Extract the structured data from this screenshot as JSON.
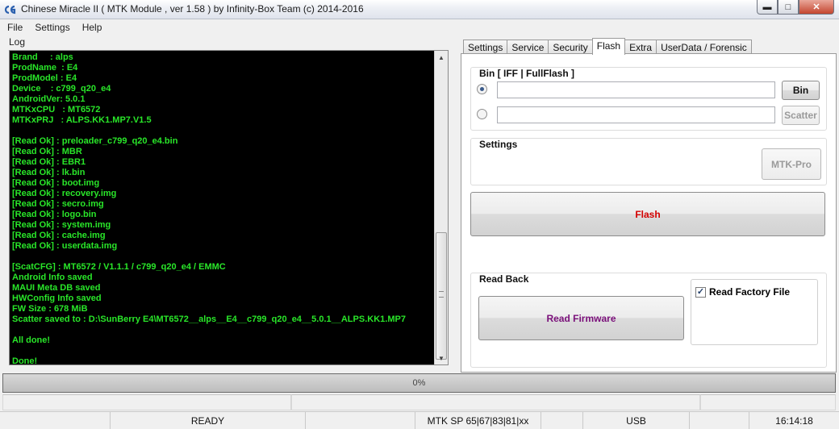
{
  "window": {
    "title": "Chinese Miracle II ( MTK Module , ver 1.58 ) by Infinity-Box Team (c) 2014-2016",
    "minimize_glyph": "▬",
    "maximize_glyph": "□",
    "close_glyph": "✕"
  },
  "menu": [
    "File",
    "Settings",
    "Help"
  ],
  "log": {
    "label": "Log",
    "lines": [
      "Brand     : alps",
      "ProdName  : E4",
      "ProdModel : E4",
      "Device    : c799_q20_e4",
      "AndroidVer: 5.0.1",
      "MTKxCPU   : MT6572",
      "MTKxPRJ   : ALPS.KK1.MP7.V1.5",
      "",
      "[Read Ok] : preloader_c799_q20_e4.bin",
      "[Read Ok] : MBR",
      "[Read Ok] : EBR1",
      "[Read Ok] : lk.bin",
      "[Read Ok] : boot.img",
      "[Read Ok] : recovery.img",
      "[Read Ok] : secro.img",
      "[Read Ok] : logo.bin",
      "[Read Ok] : system.img",
      "[Read Ok] : cache.img",
      "[Read Ok] : userdata.img",
      "",
      "[ScatCFG] : MT6572 / V1.1.1 / c799_q20_e4 / EMMC",
      "Android Info saved",
      "MAUI Meta DB saved",
      "HWConfig Info saved",
      "FW Size : 678 MiB",
      "Scatter saved to : D:\\SunBerry E4\\MT6572__alps__E4__c799_q20_e4__5.0.1__ALPS.KK1.MP7",
      "",
      "All done!",
      "",
      "Done!"
    ],
    "scroll_up_glyph": "▲",
    "scroll_down_glyph": "▼"
  },
  "tabs": [
    {
      "label": "Settings",
      "active": false
    },
    {
      "label": "Service",
      "active": false
    },
    {
      "label": "Security",
      "active": false
    },
    {
      "label": "Flash",
      "active": true
    },
    {
      "label": "Extra",
      "active": false
    },
    {
      "label": "UserData / Forensic",
      "active": false
    }
  ],
  "flash": {
    "bin_group_title": "Bin  [ IFF | FullFlash ]",
    "bin_path_value": "",
    "scatter_path_value": "",
    "bin_button": "Bin",
    "scatter_button": "Scatter",
    "settings_group_title": "Settings",
    "mtkpro_button": "MTK-Pro",
    "flash_button": "Flash",
    "flash_button_color": "#d40000",
    "readback_group_title": "Read Back",
    "read_firmware_button": "Read Firmware",
    "read_firmware_color": "#7a0f7a",
    "read_factory_file_label": "Read Factory File",
    "read_factory_file_checked": true,
    "check_glyph": "✓"
  },
  "progress": {
    "text": "0%",
    "value": 0
  },
  "status": {
    "state": "READY",
    "mtk_info": "MTK SP 65|67|83|81|xx",
    "connection": "USB",
    "time": "16:14:18"
  },
  "colors": {
    "log_background": "#000000",
    "log_text": "#29e629"
  }
}
